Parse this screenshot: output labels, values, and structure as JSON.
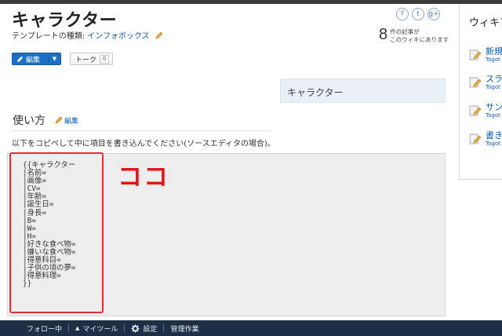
{
  "page": {
    "title": "キャラクター",
    "template_type_label": "テンプレートの種類:",
    "template_type_value": "インフォボックス"
  },
  "social": {
    "facebook": "f",
    "twitter": "t",
    "google": "g+"
  },
  "stats": {
    "article_count": "8",
    "line1": "件の記事が",
    "line2": "このウィキにあります"
  },
  "toolbar": {
    "edit_label": "編集",
    "talk_label": "トーク",
    "talk_count": "0"
  },
  "infobox": {
    "header": "キャラクター"
  },
  "usage": {
    "heading": "使い方",
    "edit_label": "編集",
    "instruction": "以下をコピペして中に項目を書き込んでください(ソースエディタの場合)。",
    "annotation": "ココ",
    "code_lines": [
      "{{キャラクター",
      "|名前=",
      "|画像=",
      "|CV=",
      "|年齢=",
      "|誕生日=",
      "|身長=",
      "|B=",
      "|W=",
      "|H=",
      "|好きな食べ物=",
      "|嫌いな食べ物=",
      "|得意科目=",
      "|子供の頃の夢=",
      "|得意料理=",
      "}}"
    ]
  },
  "sidebar": {
    "title": "ウィキア",
    "items": [
      {
        "title": "新規",
        "sub": "Togot"
      },
      {
        "title": "スラ",
        "sub": "Togot"
      },
      {
        "title": "サン",
        "sub": "Togot"
      },
      {
        "title": "書き",
        "sub": "Togot"
      }
    ]
  },
  "bottombar": {
    "follow": "フォロー中",
    "mytools": "マイツール",
    "settings": "設定",
    "admin": "管理作業"
  },
  "colors": {
    "accent": "#1d6fc4",
    "link": "#0b5ba8",
    "highlight": "#e01818",
    "footer_bg": "#1d2f44"
  }
}
